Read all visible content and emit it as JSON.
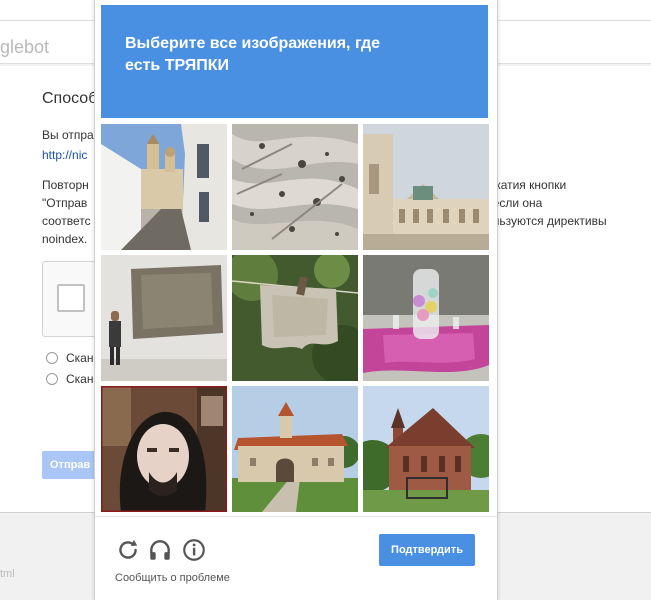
{
  "background_page": {
    "header_fragment": "glebot",
    "title_fragment": "Способ",
    "sent_fragment": "Вы отпра",
    "link_fragment": "http://nic",
    "paragraph_left": [
      "Повторн",
      "\"Отправ",
      "соответс",
      "noindex."
    ],
    "paragraph_right": [
      "ажатия кнопки",
      ", если она",
      "ользуются директивы"
    ],
    "radio_options": [
      "Скан",
      "Скан"
    ],
    "submit_fragment": "Отправ",
    "footer_fragment": "tml"
  },
  "captcha": {
    "instruction_line1": "Выберите все изображения, где",
    "instruction_line2": "есть ТРЯПКИ",
    "header_color": "#4a90e2",
    "tiles": [
      {
        "subject": "white street with church"
      },
      {
        "subject": "worn knitted cloth"
      },
      {
        "subject": "mosque building"
      },
      {
        "subject": "cloth on gallery wall"
      },
      {
        "subject": "rag on clothesline"
      },
      {
        "subject": "glass vase on pink table"
      },
      {
        "subject": "man with long hair"
      },
      {
        "subject": "old fortress building"
      },
      {
        "subject": "brick church"
      }
    ],
    "controls": {
      "reload_icon": "reload-icon",
      "audio_icon": "headphones-icon",
      "info_icon": "info-icon"
    },
    "verify_label": "Подтвердить",
    "report_label": "Сообщить о проблеме"
  }
}
